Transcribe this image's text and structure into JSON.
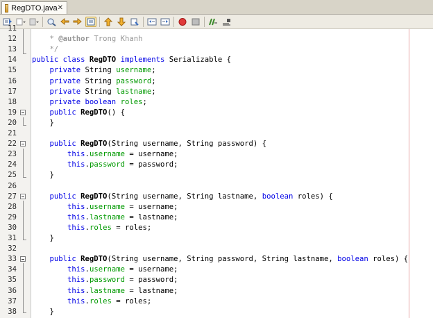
{
  "tab": {
    "title": "RegDTO.java",
    "close": "✕"
  },
  "toolbar": {
    "buttons": [
      "back-history",
      "history-dropdown",
      "forward-history",
      "forward-dropdown",
      "find-selection",
      "find-previous",
      "find-next",
      "toggle-highlight",
      "shift-left",
      "shift-right",
      "toggle-bookmark",
      "previous-bookmark",
      "next-bookmark",
      "comment",
      "uncomment",
      "start-macro",
      "stop-macro",
      "diff",
      "run"
    ]
  },
  "editor": {
    "lines": [
      {
        "n": "11",
        "parts": []
      },
      {
        "n": "12",
        "parts": [
          {
            "t": "    * ",
            "c": "cm"
          },
          {
            "t": "@author",
            "c": "ct"
          },
          {
            "t": " Trong Khanh",
            "c": "cm"
          }
        ]
      },
      {
        "n": "13",
        "parts": [
          {
            "t": "    */",
            "c": "cm"
          }
        ]
      },
      {
        "n": "14",
        "parts": [
          {
            "t": "public class ",
            "c": "kw"
          },
          {
            "t": "RegDTO",
            "c": "b"
          },
          {
            "t": " implements ",
            "c": "kw"
          },
          {
            "t": "Serializable {",
            "c": ""
          }
        ]
      },
      {
        "n": "15",
        "parts": [
          {
            "t": "    private ",
            "c": "kw"
          },
          {
            "t": "String ",
            "c": ""
          },
          {
            "t": "username",
            "c": "fd"
          },
          {
            "t": ";",
            "c": ""
          }
        ]
      },
      {
        "n": "16",
        "parts": [
          {
            "t": "    private ",
            "c": "kw"
          },
          {
            "t": "String ",
            "c": ""
          },
          {
            "t": "password",
            "c": "fd"
          },
          {
            "t": ";",
            "c": ""
          }
        ]
      },
      {
        "n": "17",
        "parts": [
          {
            "t": "    private ",
            "c": "kw"
          },
          {
            "t": "String ",
            "c": ""
          },
          {
            "t": "lastname",
            "c": "fd"
          },
          {
            "t": ";",
            "c": ""
          }
        ]
      },
      {
        "n": "18",
        "parts": [
          {
            "t": "    private boolean ",
            "c": "kw"
          },
          {
            "t": "roles",
            "c": "fd"
          },
          {
            "t": ";",
            "c": ""
          }
        ]
      },
      {
        "n": "19",
        "parts": [
          {
            "t": "    public ",
            "c": "kw"
          },
          {
            "t": "RegDTO",
            "c": "b"
          },
          {
            "t": "() {",
            "c": ""
          }
        ]
      },
      {
        "n": "20",
        "parts": [
          {
            "t": "    }",
            "c": ""
          }
        ]
      },
      {
        "n": "21",
        "parts": []
      },
      {
        "n": "22",
        "parts": [
          {
            "t": "    public ",
            "c": "kw"
          },
          {
            "t": "RegDTO",
            "c": "b"
          },
          {
            "t": "(String username, String password) {",
            "c": ""
          }
        ]
      },
      {
        "n": "23",
        "parts": [
          {
            "t": "        this",
            "c": "kw"
          },
          {
            "t": ".",
            "c": ""
          },
          {
            "t": "username",
            "c": "fd"
          },
          {
            "t": " = username;",
            "c": ""
          }
        ]
      },
      {
        "n": "24",
        "parts": [
          {
            "t": "        this",
            "c": "kw"
          },
          {
            "t": ".",
            "c": ""
          },
          {
            "t": "password",
            "c": "fd"
          },
          {
            "t": " = password;",
            "c": ""
          }
        ]
      },
      {
        "n": "25",
        "parts": [
          {
            "t": "    }",
            "c": ""
          }
        ]
      },
      {
        "n": "26",
        "parts": []
      },
      {
        "n": "27",
        "parts": [
          {
            "t": "    public ",
            "c": "kw"
          },
          {
            "t": "RegDTO",
            "c": "b"
          },
          {
            "t": "(String username, String lastname, ",
            "c": ""
          },
          {
            "t": "boolean",
            "c": "kw"
          },
          {
            "t": " roles) {",
            "c": ""
          }
        ]
      },
      {
        "n": "28",
        "parts": [
          {
            "t": "        this",
            "c": "kw"
          },
          {
            "t": ".",
            "c": ""
          },
          {
            "t": "username",
            "c": "fd"
          },
          {
            "t": " = username;",
            "c": ""
          }
        ]
      },
      {
        "n": "29",
        "parts": [
          {
            "t": "        this",
            "c": "kw"
          },
          {
            "t": ".",
            "c": ""
          },
          {
            "t": "lastname",
            "c": "fd"
          },
          {
            "t": " = lastname;",
            "c": ""
          }
        ]
      },
      {
        "n": "30",
        "parts": [
          {
            "t": "        this",
            "c": "kw"
          },
          {
            "t": ".",
            "c": ""
          },
          {
            "t": "roles",
            "c": "fd"
          },
          {
            "t": " = roles;",
            "c": ""
          }
        ]
      },
      {
        "n": "31",
        "parts": [
          {
            "t": "    }",
            "c": ""
          }
        ]
      },
      {
        "n": "32",
        "parts": []
      },
      {
        "n": "33",
        "parts": [
          {
            "t": "    public ",
            "c": "kw"
          },
          {
            "t": "RegDTO",
            "c": "b"
          },
          {
            "t": "(String username, String password, String lastname, ",
            "c": ""
          },
          {
            "t": "boolean",
            "c": "kw"
          },
          {
            "t": " roles) {",
            "c": ""
          }
        ]
      },
      {
        "n": "34",
        "parts": [
          {
            "t": "        this",
            "c": "kw"
          },
          {
            "t": ".",
            "c": ""
          },
          {
            "t": "username",
            "c": "fd"
          },
          {
            "t": " = username;",
            "c": ""
          }
        ]
      },
      {
        "n": "35",
        "parts": [
          {
            "t": "        this",
            "c": "kw"
          },
          {
            "t": ".",
            "c": ""
          },
          {
            "t": "password",
            "c": "fd"
          },
          {
            "t": " = password;",
            "c": ""
          }
        ]
      },
      {
        "n": "36",
        "parts": [
          {
            "t": "        this",
            "c": "kw"
          },
          {
            "t": ".",
            "c": ""
          },
          {
            "t": "lastname",
            "c": "fd"
          },
          {
            "t": " = lastname;",
            "c": ""
          }
        ]
      },
      {
        "n": "37",
        "parts": [
          {
            "t": "        this",
            "c": "kw"
          },
          {
            "t": ".",
            "c": ""
          },
          {
            "t": "roles",
            "c": "fd"
          },
          {
            "t": " = roles;",
            "c": ""
          }
        ]
      },
      {
        "n": "38",
        "parts": [
          {
            "t": "    }",
            "c": ""
          }
        ]
      }
    ]
  },
  "colors": {
    "keyword": "#0000e6",
    "field": "#009900",
    "comment": "#969696",
    "margin": "#e8a5a5"
  }
}
